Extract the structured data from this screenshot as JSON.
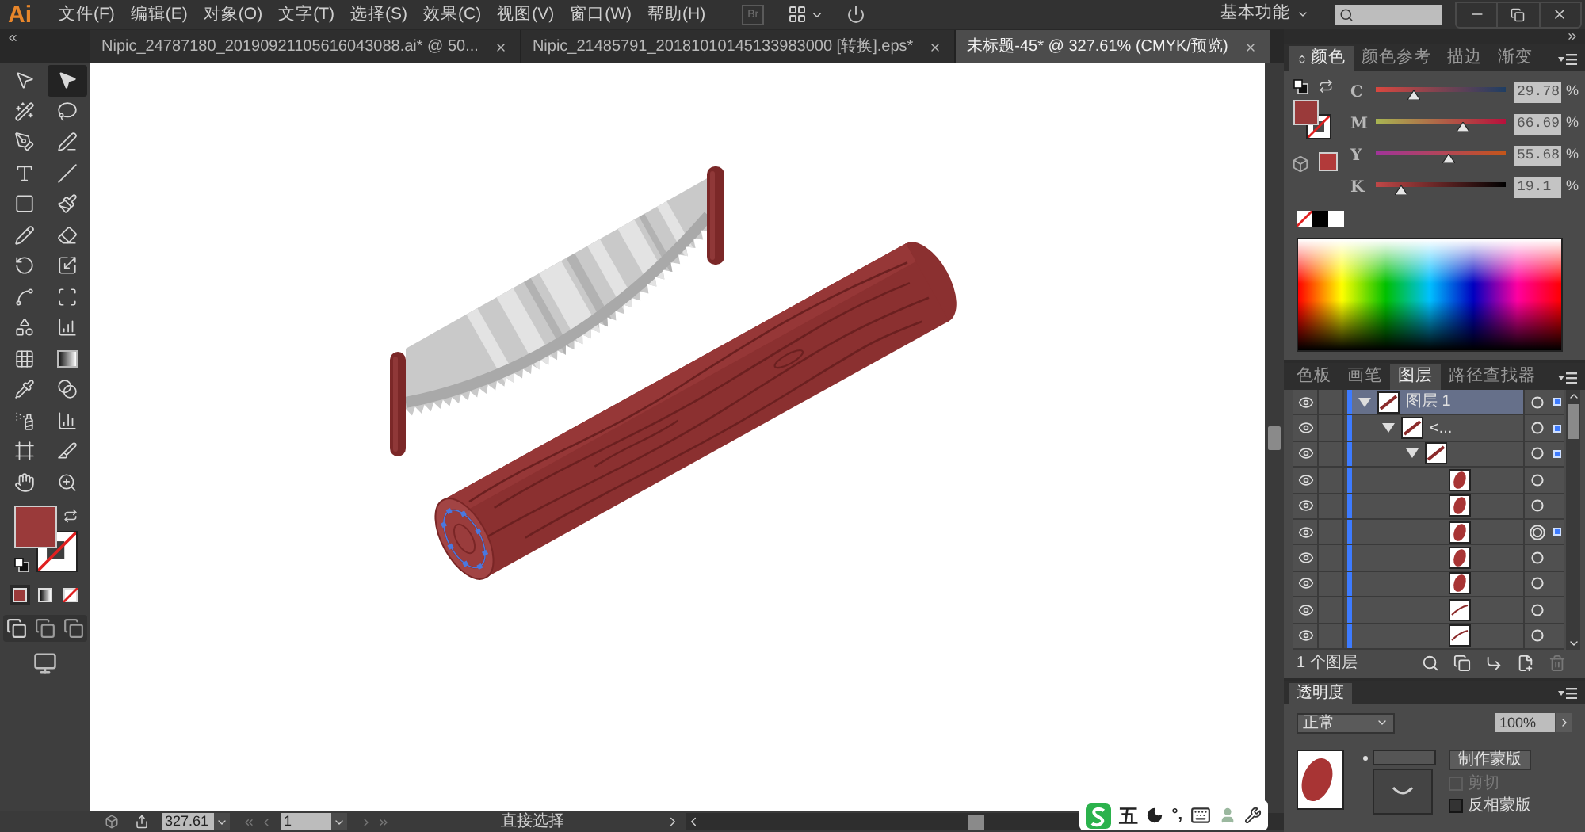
{
  "app": {
    "logo": "Ai",
    "bridge": "Br"
  },
  "menu": [
    {
      "label": "文件(F)"
    },
    {
      "label": "编辑(E)"
    },
    {
      "label": "对象(O)"
    },
    {
      "label": "文字(T)"
    },
    {
      "label": "选择(S)"
    },
    {
      "label": "效果(C)"
    },
    {
      "label": "视图(V)"
    },
    {
      "label": "窗口(W)"
    },
    {
      "label": "帮助(H)"
    }
  ],
  "workspace": {
    "label": "基本功能"
  },
  "document_tabs": [
    {
      "title": "Nipic_24787180_20190921105616043088.ai* @ 50...",
      "selected": false
    },
    {
      "title": "Nipic_21485791_20181010145133983000 [转换].eps*",
      "selected": false
    },
    {
      "title": "未标题-45* @ 327.61% (CMYK/预览)",
      "selected": true
    }
  ],
  "tools": [
    {
      "kind": "selection",
      "selected": false
    },
    {
      "kind": "direct-selection",
      "selected": true
    },
    {
      "kind": "magic-wand",
      "selected": false
    },
    {
      "kind": "lasso",
      "selected": false
    },
    {
      "kind": "pen",
      "selected": false
    },
    {
      "kind": "curvature",
      "selected": false
    },
    {
      "kind": "type",
      "selected": false
    },
    {
      "kind": "line",
      "selected": false
    },
    {
      "kind": "rectangle",
      "selected": false
    },
    {
      "kind": "paintbrush",
      "selected": false
    },
    {
      "kind": "pencil",
      "selected": false
    },
    {
      "kind": "eraser",
      "selected": false
    },
    {
      "kind": "rotate",
      "selected": false
    },
    {
      "kind": "scale",
      "selected": false
    },
    {
      "kind": "warp",
      "selected": false
    },
    {
      "kind": "free-transform",
      "selected": false
    },
    {
      "kind": "shape-builder",
      "selected": false
    },
    {
      "kind": "perspective",
      "selected": false
    },
    {
      "kind": "mesh",
      "selected": false
    },
    {
      "kind": "gradient",
      "selected": false
    },
    {
      "kind": "eyedropper",
      "selected": false
    },
    {
      "kind": "blend",
      "selected": false
    },
    {
      "kind": "symbol-sprayer",
      "selected": false
    },
    {
      "kind": "graph",
      "selected": false
    },
    {
      "kind": "artboard",
      "selected": false
    },
    {
      "kind": "slice",
      "selected": false
    },
    {
      "kind": "hand",
      "selected": false
    },
    {
      "kind": "zoom",
      "selected": false
    }
  ],
  "color_panel": {
    "tabs": [
      {
        "label": "颜色",
        "selected": true
      },
      {
        "label": "颜色参考",
        "selected": false
      },
      {
        "label": "描边",
        "selected": false
      },
      {
        "label": "渐变",
        "selected": false
      }
    ],
    "channels": [
      {
        "kind": "cyan",
        "label": "C",
        "value": "29.78",
        "unit": "%",
        "level": 0.2978
      },
      {
        "kind": "magenta",
        "label": "M",
        "value": "66.69",
        "unit": "%",
        "level": 0.6669
      },
      {
        "kind": "yellow",
        "label": "Y",
        "value": "55.68",
        "unit": "%",
        "level": 0.5568
      },
      {
        "kind": "black",
        "label": "K",
        "value": "19.1",
        "unit": "%",
        "level": 0.191
      }
    ]
  },
  "layers_panel": {
    "tabs": [
      {
        "label": "色板",
        "selected": false
      },
      {
        "label": "画笔",
        "selected": false
      },
      {
        "label": "图层",
        "selected": true
      },
      {
        "label": "路径查找器",
        "selected": false
      }
    ],
    "layers": [
      {
        "name": "图层 1",
        "kind": "line",
        "expanded": true,
        "visible": true,
        "active": true,
        "selected": true,
        "targeted": false,
        "children": [
          {
            "name": "<...",
            "kind": "line",
            "expanded": true,
            "visible": true,
            "active": false,
            "selected": true,
            "targeted": false,
            "children": [
              {
                "kind": "line",
                "expanded": true,
                "visible": true,
                "active": false,
                "selected": true,
                "targeted": false,
                "children": [
                  {
                    "kind": "oval",
                    "visible": true,
                    "active": false,
                    "selected": false,
                    "targeted": false
                  },
                  {
                    "kind": "oval",
                    "visible": true,
                    "active": false,
                    "selected": false,
                    "targeted": false
                  },
                  {
                    "kind": "oval",
                    "visible": true,
                    "active": false,
                    "selected": true,
                    "targeted": true
                  },
                  {
                    "kind": "oval",
                    "visible": true,
                    "active": false,
                    "selected": false,
                    "targeted": false
                  },
                  {
                    "kind": "oval",
                    "visible": true,
                    "active": false,
                    "selected": false,
                    "targeted": false
                  },
                  {
                    "kind": "stroke",
                    "visible": true,
                    "active": false,
                    "selected": false,
                    "targeted": false
                  },
                  {
                    "kind": "stroke",
                    "visible": true,
                    "active": false,
                    "selected": false,
                    "targeted": false
                  }
                ]
              }
            ]
          }
        ]
      }
    ],
    "count": "1 个图层"
  },
  "transparency_panel": {
    "title": "透明度",
    "blend_mode": "正常",
    "opacity": "100%",
    "make_mask": "制作蒙版",
    "options": [
      {
        "label": "剪切",
        "checked": false,
        "disabled": true
      },
      {
        "label": "反相蒙版",
        "checked": false,
        "disabled": false
      }
    ]
  },
  "status_bar": {
    "zoom": "327.61",
    "artboard": "1",
    "tool": "直接选择"
  },
  "ime": {
    "mode": "五",
    "punctuation": "°,"
  }
}
